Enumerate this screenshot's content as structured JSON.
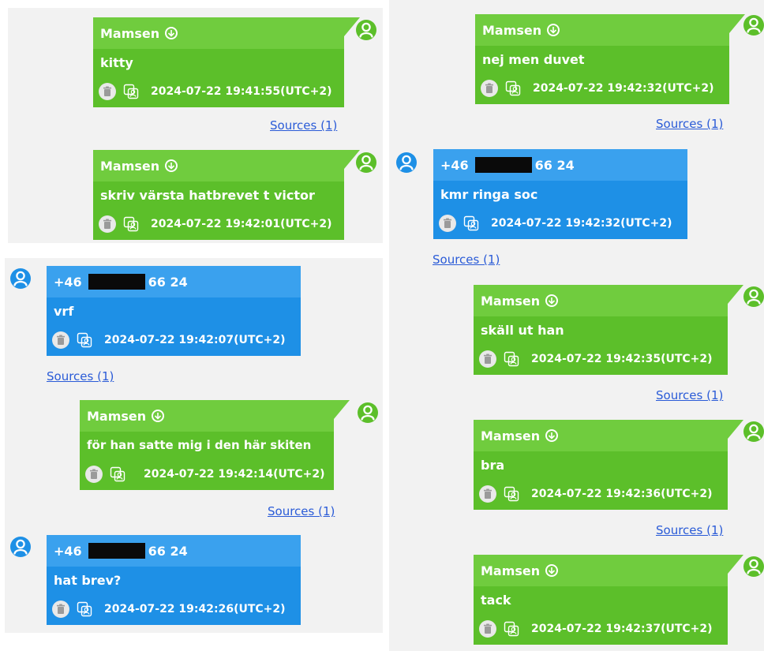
{
  "accent_colors": {
    "outgoing": "#5cbf2a",
    "incoming": "#1e90e6",
    "link": "#2a5bd7"
  },
  "panel_a": {
    "m1": {
      "sender": "Mamsen",
      "text": "kitty",
      "timestamp": "2024-07-22 19:41:55(UTC+2)",
      "sources": "Sources (1)"
    },
    "m2": {
      "sender": "Mamsen",
      "text": "skriv värsta hatbrevet t victor",
      "timestamp": "2024-07-22 19:42:01(UTC+2)"
    }
  },
  "panel_b": {
    "m1": {
      "sender_prefix": "+46",
      "sender_suffix": "66 24",
      "text": "vrf",
      "timestamp": "2024-07-22 19:42:07(UTC+2)",
      "sources": "Sources (1)"
    },
    "m2": {
      "sender": "Mamsen",
      "text": "för han satte mig i den här skiten",
      "timestamp": "2024-07-22 19:42:14(UTC+2)",
      "sources": "Sources (1)"
    },
    "m3": {
      "sender_prefix": "+46",
      "sender_suffix": "66 24",
      "text": "hat brev?",
      "timestamp": "2024-07-22 19:42:26(UTC+2)"
    }
  },
  "panel_c": {
    "m1": {
      "sender": "Mamsen",
      "text": "nej men duvet",
      "timestamp": "2024-07-22 19:42:32(UTC+2)",
      "sources": "Sources (1)"
    },
    "m2": {
      "sender_prefix": "+46",
      "sender_suffix": "66 24",
      "text": "kmr ringa soc",
      "timestamp": "2024-07-22 19:42:32(UTC+2)",
      "sources": "Sources (1)"
    },
    "m3": {
      "sender": "Mamsen",
      "text": "skäll ut han",
      "timestamp": "2024-07-22 19:42:35(UTC+2)",
      "sources": "Sources (1)"
    },
    "m4": {
      "sender": "Mamsen",
      "text": "bra",
      "timestamp": "2024-07-22 19:42:36(UTC+2)",
      "sources": "Sources (1)"
    },
    "m5": {
      "sender": "Mamsen",
      "text": "tack",
      "timestamp": "2024-07-22 19:42:37(UTC+2)"
    }
  },
  "icons": [
    "forwarded-icon",
    "trash-icon",
    "copy-icon",
    "user-avatar-icon"
  ]
}
